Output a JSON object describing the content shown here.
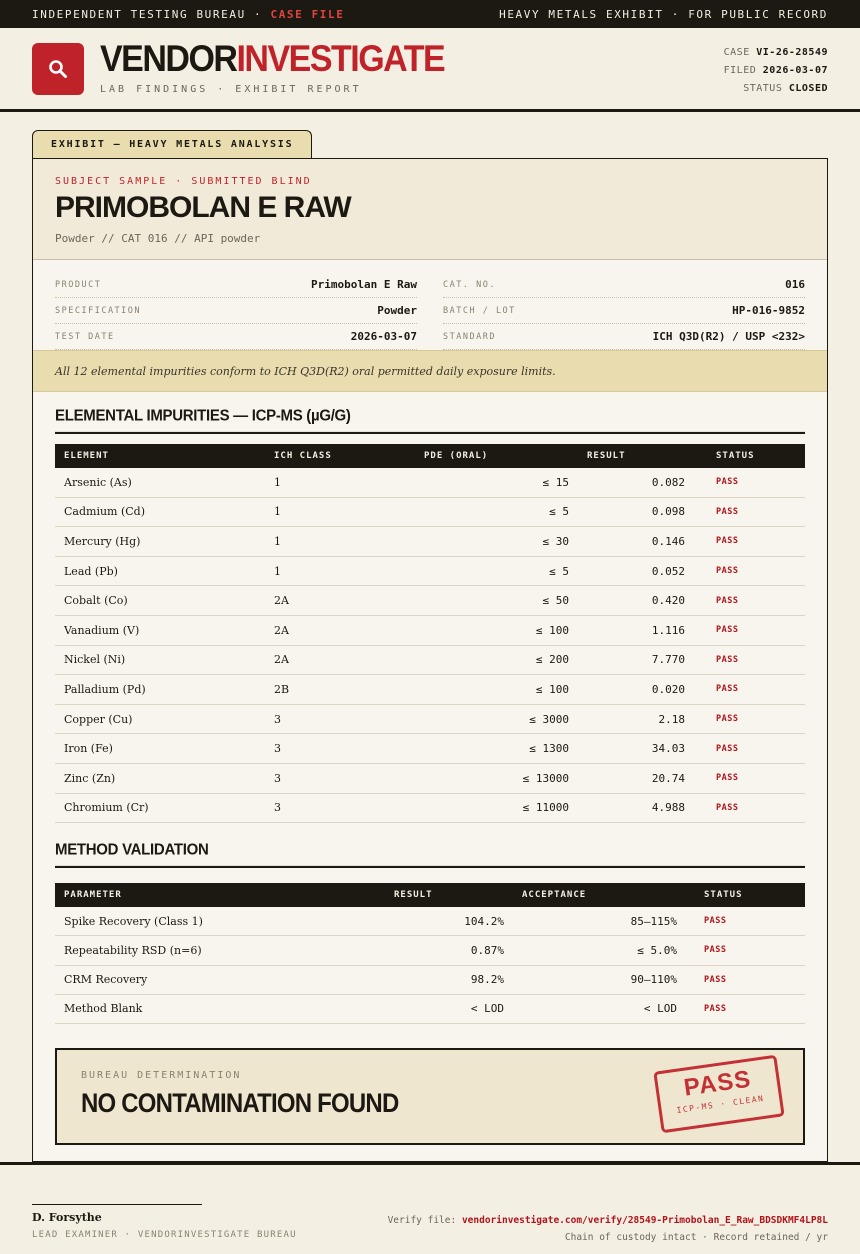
{
  "topbar": {
    "left_prefix": "INDEPENDENT TESTING BUREAU ·",
    "left_highlight": "CASE FILE",
    "right": "HEAVY METALS EXHIBIT · FOR PUBLIC RECORD"
  },
  "brand": {
    "name_part1": "VENDOR",
    "name_part2": "INVESTIGATE",
    "subtitle": "LAB FINDINGS · EXHIBIT REPORT",
    "icon": "magnifier-icon"
  },
  "case_meta": [
    {
      "label": "CASE",
      "value": "VI-26-28549"
    },
    {
      "label": "FILED",
      "value": "2026-03-07"
    },
    {
      "label": "STATUS",
      "value": "CLOSED"
    }
  ],
  "exhibit_tab": "EXHIBIT — HEAVY METALS ANALYSIS",
  "subject": {
    "kicker": "SUBJECT SAMPLE · SUBMITTED BLIND",
    "title": "PRIMOBOLAN E RAW",
    "meta": "Powder  //  CAT 016  //  API powder"
  },
  "details_left": [
    {
      "label": "PRODUCT",
      "value": "Primobolan E Raw"
    },
    {
      "label": "SPECIFICATION",
      "value": "Powder"
    },
    {
      "label": "TEST DATE",
      "value": "2026-03-07"
    }
  ],
  "details_right": [
    {
      "label": "CAT. NO.",
      "value": "016"
    },
    {
      "label": "BATCH / LOT",
      "value": "HP-016-9852"
    },
    {
      "label": "STANDARD",
      "value": "ICH Q3D(R2) / USP <232>"
    }
  ],
  "conformance_note": "All 12 elemental impurities conform to ICH Q3D(R2) oral permitted daily exposure limits.",
  "impurities": {
    "title": "ELEMENTAL IMPURITIES — ICP-MS (µG/G)",
    "columns": [
      "ELEMENT",
      "ICH CLASS",
      "PDE (ORAL)",
      "RESULT",
      "STATUS"
    ],
    "rows": [
      {
        "element": "Arsenic (As)",
        "class": "1",
        "pde": "≤ 15",
        "result": "0.082",
        "status": "PASS"
      },
      {
        "element": "Cadmium (Cd)",
        "class": "1",
        "pde": "≤ 5",
        "result": "0.098",
        "status": "PASS"
      },
      {
        "element": "Mercury (Hg)",
        "class": "1",
        "pde": "≤ 30",
        "result": "0.146",
        "status": "PASS"
      },
      {
        "element": "Lead (Pb)",
        "class": "1",
        "pde": "≤ 5",
        "result": "0.052",
        "status": "PASS"
      },
      {
        "element": "Cobalt (Co)",
        "class": "2A",
        "pde": "≤ 50",
        "result": "0.420",
        "status": "PASS"
      },
      {
        "element": "Vanadium (V)",
        "class": "2A",
        "pde": "≤ 100",
        "result": "1.116",
        "status": "PASS"
      },
      {
        "element": "Nickel (Ni)",
        "class": "2A",
        "pde": "≤ 200",
        "result": "7.770",
        "status": "PASS"
      },
      {
        "element": "Palladium (Pd)",
        "class": "2B",
        "pde": "≤ 100",
        "result": "0.020",
        "status": "PASS"
      },
      {
        "element": "Copper (Cu)",
        "class": "3",
        "pde": "≤ 3000",
        "result": "2.18",
        "status": "PASS"
      },
      {
        "element": "Iron (Fe)",
        "class": "3",
        "pde": "≤ 1300",
        "result": "34.03",
        "status": "PASS"
      },
      {
        "element": "Zinc (Zn)",
        "class": "3",
        "pde": "≤ 13000",
        "result": "20.74",
        "status": "PASS"
      },
      {
        "element": "Chromium (Cr)",
        "class": "3",
        "pde": "≤ 11000",
        "result": "4.988",
        "status": "PASS"
      }
    ]
  },
  "method": {
    "title": "METHOD VALIDATION",
    "columns": [
      "PARAMETER",
      "RESULT",
      "ACCEPTANCE",
      "STATUS"
    ],
    "rows": [
      {
        "parameter": "Spike Recovery (Class 1)",
        "result": "104.2%",
        "acceptance": "85–115%",
        "status": "PASS"
      },
      {
        "parameter": "Repeatability RSD (n=6)",
        "result": "0.87%",
        "acceptance": "≤ 5.0%",
        "status": "PASS"
      },
      {
        "parameter": "CRM Recovery",
        "result": "98.2%",
        "acceptance": "90–110%",
        "status": "PASS"
      },
      {
        "parameter": "Method Blank",
        "result": "< LOD",
        "acceptance": "< LOD",
        "status": "PASS"
      }
    ]
  },
  "determination": {
    "label": "BUREAU DETERMINATION",
    "verdict": "NO CONTAMINATION FOUND",
    "stamp_main": "PASS",
    "stamp_sub": "ICP-MS · CLEAN"
  },
  "footer": {
    "signer_name": "D. Forsythe",
    "signer_role": "LEAD EXAMINER · VENDORINVESTIGATE BUREAU",
    "verify_label": "Verify file:",
    "verify_url": "vendorinvestigate.com/verify/28549-Primobolan_E_Raw_BDSDKMF4LP8L",
    "custody": "Chain of custody intact · Record retained / yr"
  }
}
